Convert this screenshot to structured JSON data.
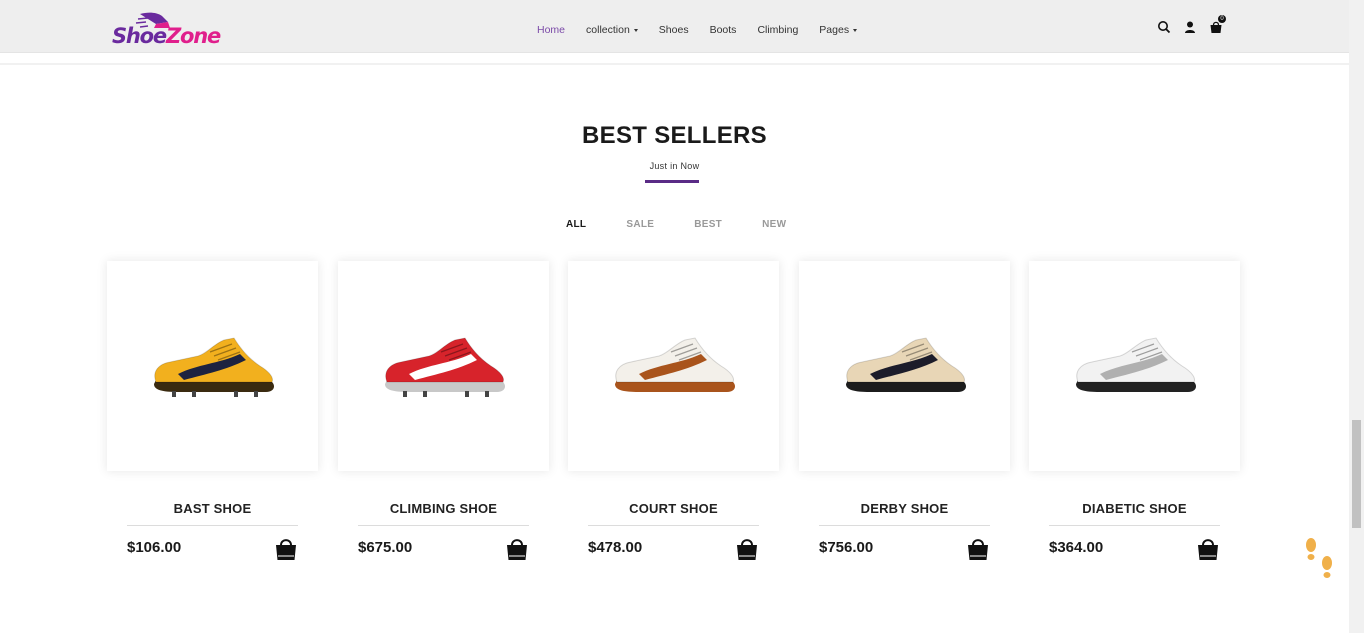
{
  "brand": {
    "logo_alt": "ShoeZone",
    "logo_part1": "Shoe",
    "logo_part2": "Zone"
  },
  "nav": {
    "items": [
      {
        "label": "Home",
        "active": true,
        "dropdown": false
      },
      {
        "label": "collection",
        "active": false,
        "dropdown": true
      },
      {
        "label": "Shoes",
        "active": false,
        "dropdown": false
      },
      {
        "label": "Boots",
        "active": false,
        "dropdown": false
      },
      {
        "label": "Climbing",
        "active": false,
        "dropdown": false
      },
      {
        "label": "Pages",
        "active": false,
        "dropdown": true
      }
    ]
  },
  "header_icons": {
    "search": "search-icon",
    "account": "user-icon",
    "cart": "cart-icon",
    "cart_count": "0"
  },
  "section": {
    "title": "BEST SELLERS",
    "subtitle": "Just in Now",
    "accent_color": "#5a2b86"
  },
  "filters": [
    {
      "label": "ALL",
      "active": true
    },
    {
      "label": "SALE",
      "active": false
    },
    {
      "label": "BEST",
      "active": false
    },
    {
      "label": "NEW",
      "active": false
    }
  ],
  "products": [
    {
      "name": "BAST SHOE",
      "price": "$106.00",
      "shoe_color": "#f2b01e",
      "accent": "#1d2340",
      "sole": "#3a2a10"
    },
    {
      "name": "CLIMBING SHOE",
      "price": "$675.00",
      "shoe_color": "#d7232b",
      "accent": "#ffffff",
      "sole": "#c8c8c8"
    },
    {
      "name": "COURT SHOE",
      "price": "$478.00",
      "shoe_color": "#f3f0ea",
      "accent": "#a9541c",
      "sole": "#a9541c"
    },
    {
      "name": "DERBY SHOE",
      "price": "$756.00",
      "shoe_color": "#e8d6b6",
      "accent": "#1c1c2a",
      "sole": "#1c1c1c"
    },
    {
      "name": "DIABETIC SHOE",
      "price": "$364.00",
      "shoe_color": "#f2f2f2",
      "accent": "#b0b0b0",
      "sole": "#222222"
    }
  ]
}
